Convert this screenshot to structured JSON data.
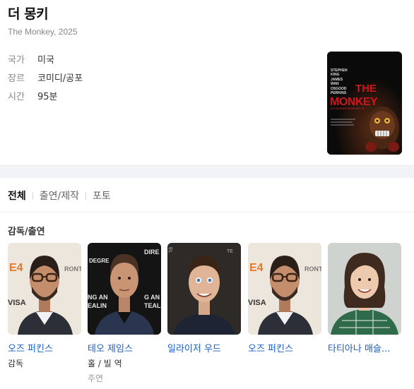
{
  "movie": {
    "title": "더 몽키",
    "subtitle": "The Monkey, 2025",
    "meta": [
      {
        "key": "국가",
        "value": "미국"
      },
      {
        "key": "장르",
        "value": "코미디/공포"
      },
      {
        "key": "시간",
        "value": "95분"
      }
    ],
    "poster": {
      "credits_top": [
        "STEPHEN",
        "KING",
        "JAMES",
        "WAN",
        "OSGOOD",
        "PERKINS"
      ],
      "title_the": "THE",
      "title_main": "MONKEY",
      "tagline": "IN THEATERS FEBRUARY 21"
    }
  },
  "tabs": [
    "전체",
    "출연/제작",
    "포토"
  ],
  "section_title": "감독/출연",
  "cast": [
    {
      "name": "오즈 퍼킨스",
      "role": "감독",
      "role2": ""
    },
    {
      "name": "테오 제임스",
      "role": "홀 / 빌 역",
      "role2": "주연"
    },
    {
      "name": "일라이저 우드",
      "role": "",
      "role2": ""
    },
    {
      "name": "오즈 퍼킨스",
      "role": "",
      "role2": ""
    },
    {
      "name": "타티아나 매슬...",
      "role": "",
      "role2": ""
    }
  ],
  "colors": {
    "link": "#1a5ec1",
    "poster_red": "#d3141a"
  }
}
